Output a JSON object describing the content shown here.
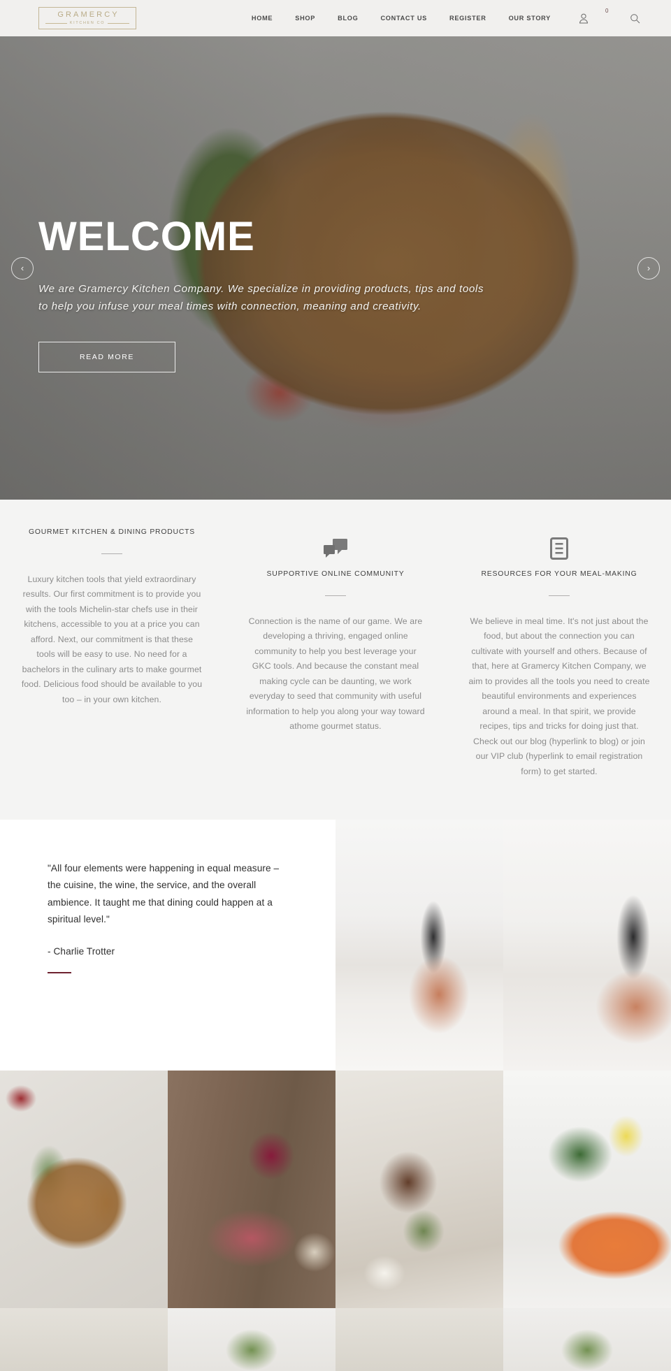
{
  "header": {
    "logo": {
      "main": "GRAMERCY",
      "sub": "KITCHEN CO"
    },
    "nav": [
      {
        "label": "HOME"
      },
      {
        "label": "SHOP"
      },
      {
        "label": "BLOG"
      },
      {
        "label": "CONTACT US"
      },
      {
        "label": "REGISTER"
      },
      {
        "label": "OUR STORY"
      }
    ],
    "icons": {
      "account": "account-icon",
      "cart": "cart-icon",
      "cart_count": "0",
      "search": "search-icon"
    }
  },
  "hero": {
    "title": "WELCOME",
    "subtitle": "We are Gramercy Kitchen Company. We specialize in providing products, tips and tools to help you infuse your meal times with connection, meaning and creativity.",
    "button": "READ MORE",
    "prev_arrow": "‹",
    "next_arrow": "›"
  },
  "features": [
    {
      "icon": "",
      "title": "GOURMET KITCHEN & DINING PRODUCTS",
      "body": "Luxury kitchen tools that yield extraordinary results. Our first commitment is to provide you with the tools Michelin-star chefs use in their kitchens, accessible to you at a price you can afford. Next, our commitment is that these tools will be easy to use. No need for a bachelors in the culinary arts to make gourmet food. Delicious food should be available to you too – in your own kitchen."
    },
    {
      "icon": "speech-bubbles-icon",
      "title": "SUPPORTIVE ONLINE COMMUNITY",
      "body": "Connection is the name of our game. We are developing a thriving, engaged online community to help you best leverage your GKC tools. And because the constant meal making cycle can be daunting, we work everyday to seed that community with useful information to help you along your way toward athome gourmet status."
    },
    {
      "icon": "document-icon",
      "title": "RESOURCES FOR YOUR MEAL-MAKING",
      "body": "We believe in meal time. It's not just about the food, but about the connection you can cultivate with yourself and others. Because of that, here at Gramercy Kitchen Company, we aim to provides all the tools you need to create beautiful environments and experiences around a meal. In that spirit, we provide recipes, tips and tricks for doing just that. Check out our blog (hyperlink to blog) or join our VIP club (hyperlink to email registration form) to get started."
    }
  ],
  "quote": {
    "text": "\"All four elements were happening in equal measure – the cuisine, the wine, the service, and the overall ambience. It taught me that dining could happen at a spiritual level.\"",
    "author": "- Charlie Trotter"
  },
  "colors": {
    "logo_gold": "#b9ab87",
    "header_bg": "#f1f0ee",
    "features_bg": "#f4f4f3",
    "quote_accent": "#6e2230",
    "body_text": "#8b8b8b"
  }
}
